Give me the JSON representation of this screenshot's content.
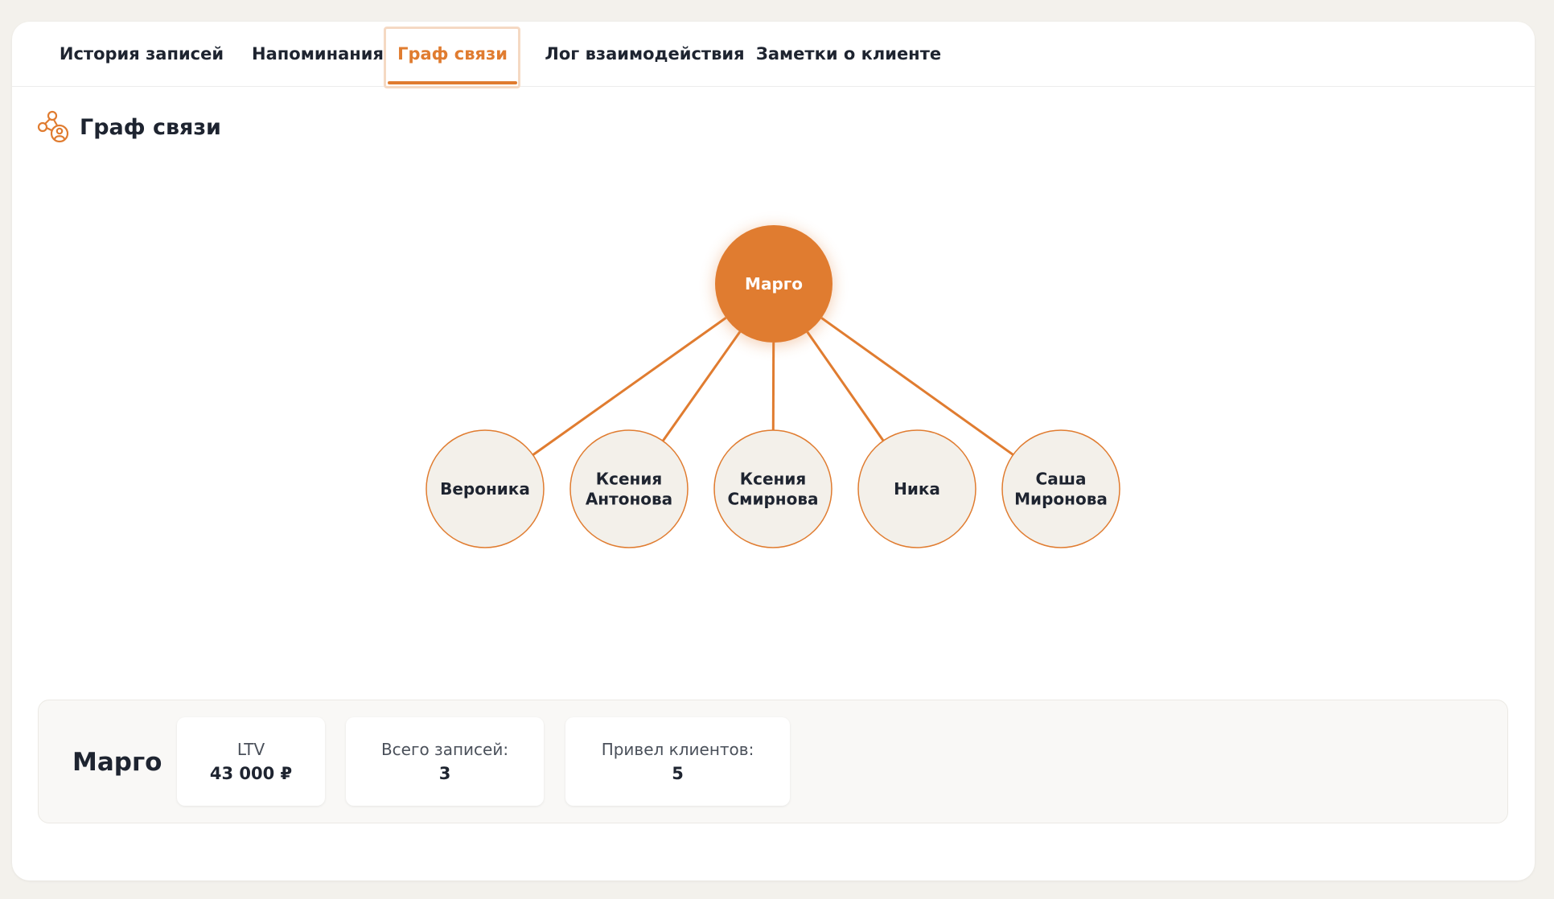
{
  "tabs": [
    {
      "label": "История записей"
    },
    {
      "label": "Напоминания"
    },
    {
      "label": "Граф связи",
      "active": true
    },
    {
      "label": "Лог взаимодействия"
    },
    {
      "label": "Заметки о клиенте"
    }
  ],
  "section": {
    "title": "Граф связи",
    "icon": "connection-graph-icon"
  },
  "graph": {
    "center": {
      "name": "Марго"
    },
    "children": [
      {
        "lines": [
          "Вероника"
        ]
      },
      {
        "lines": [
          "Ксения",
          "Антонова"
        ]
      },
      {
        "lines": [
          "Ксения",
          "Смирнова"
        ]
      },
      {
        "lines": [
          "Ника"
        ]
      },
      {
        "lines": [
          "Саша",
          "Миронова"
        ]
      }
    ]
  },
  "summary": {
    "name": "Марго",
    "stats": [
      {
        "label": "LTV",
        "value": "43 000 ₽"
      },
      {
        "label": "Всего записей:",
        "value": "3"
      },
      {
        "label": "Привел клиентов:",
        "value": "5"
      }
    ]
  },
  "colors": {
    "accent": "#e07c30",
    "node_fill": "#f3f0ea",
    "text": "#1e2430"
  }
}
